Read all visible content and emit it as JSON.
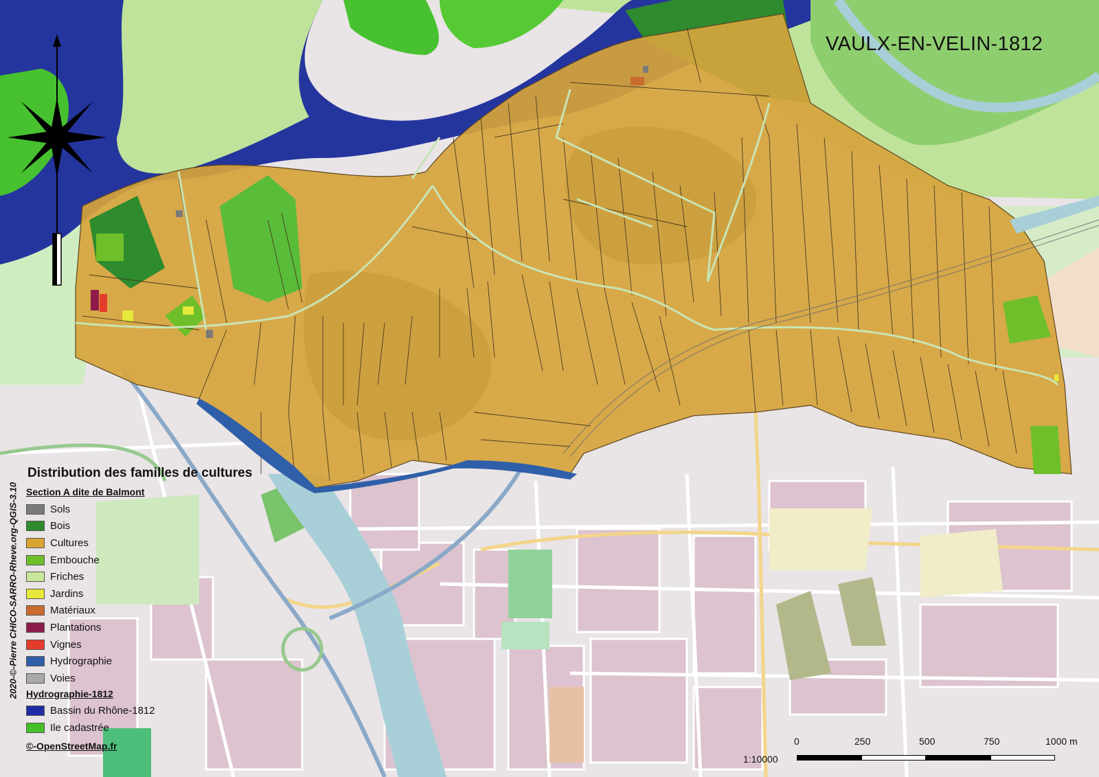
{
  "map": {
    "title": "VAULX-EN-VELIN-1812",
    "credit": "2020-©-Pierre CHICO-SARRO-Rheve.org-QGIS-3.10"
  },
  "legend": {
    "heading": "Distribution des familles de cultures",
    "section_cadastre": "Section A dite de Balmont",
    "items": [
      {
        "label": "Sols",
        "color": "#7a7a7a"
      },
      {
        "label": "Bois",
        "color": "#2e8b2e"
      },
      {
        "label": "Cultures",
        "color": "#d9a431"
      },
      {
        "label": "Embouche",
        "color": "#6fbf2a"
      },
      {
        "label": "Friches",
        "color": "#c8e79a"
      },
      {
        "label": "Jardins",
        "color": "#e6e83a"
      },
      {
        "label": "Matériaux",
        "color": "#c96b2e"
      },
      {
        "label": "Plantations",
        "color": "#8e1c4a"
      },
      {
        "label": "Vignes",
        "color": "#e53b2b"
      },
      {
        "label": "Hydrographie",
        "color": "#2f5fa8"
      },
      {
        "label": "Voies",
        "color": "#a9a9a9"
      }
    ],
    "section_hydro": "Hydrographie-1812",
    "hydro_items": [
      {
        "label": "Bassin du Rhône-1812",
        "color": "#1f2ca6"
      },
      {
        "label": "Ile cadastrée",
        "color": "#44c02a"
      }
    ],
    "osm": "©-OpenStreetMap.fr"
  },
  "scalebar": {
    "ratio": "1:10000",
    "ticks": [
      "0",
      "250",
      "500",
      "750",
      "1000 m"
    ]
  },
  "colors": {
    "background_city": "#e6e1e3",
    "river_modern": "#a9d2da",
    "parcel_fill": "#d6a43c",
    "parcel_stroke": "#4a3a20",
    "rhone_1812": "#25359e",
    "island": "#47c12f",
    "friche": "#bfe39a"
  }
}
